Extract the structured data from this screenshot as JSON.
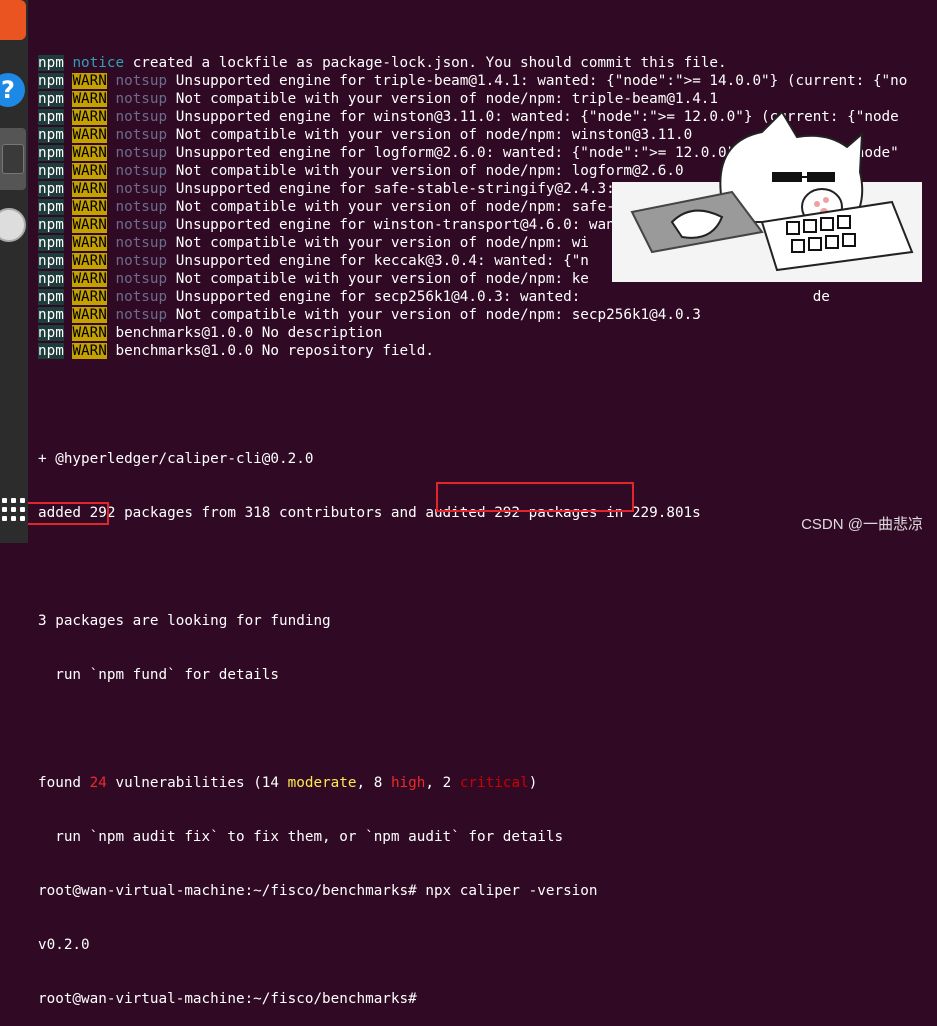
{
  "terminal": {
    "lines": [
      {
        "prefix": "npm",
        "tag": "notice",
        "tag_type": "notice",
        "rest": " created a lockfile as package-lock.json. You should commit this file."
      },
      {
        "prefix": "npm",
        "tag": "WARN",
        "tag_type": "warn",
        "code": "notsup",
        "rest": " Unsupported engine for triple-beam@1.4.1: wanted: {\"node\":\">= 14.0.0\"} (current: {\"no"
      },
      {
        "prefix": "npm",
        "tag": "WARN",
        "tag_type": "warn",
        "code": "notsup",
        "rest": " Not compatible with your version of node/npm: triple-beam@1.4.1"
      },
      {
        "prefix": "npm",
        "tag": "WARN",
        "tag_type": "warn",
        "code": "notsup",
        "rest": " Unsupported engine for winston@3.11.0: wanted: {\"node\":\">= 12.0.0\"} (current: {\"node"
      },
      {
        "prefix": "npm",
        "tag": "WARN",
        "tag_type": "warn",
        "code": "notsup",
        "rest": " Not compatible with your version of node/npm: winston@3.11.0"
      },
      {
        "prefix": "npm",
        "tag": "WARN",
        "tag_type": "warn",
        "code": "notsup",
        "rest": " Unsupported engine for logform@2.6.0: wanted: {\"node\":\">= 12.0.0\"} (current: {\"node\""
      },
      {
        "prefix": "npm",
        "tag": "WARN",
        "tag_type": "warn",
        "code": "notsup",
        "rest": " Not compatible with your version of node/npm: logform@2.6.0"
      },
      {
        "prefix": "npm",
        "tag": "WARN",
        "tag_type": "warn",
        "code": "notsup",
        "rest": " Unsupported engine for safe-stable-stringify@2.4.3: wanted: {\"node\":\">= 10\"} (current"
      },
      {
        "prefix": "npm",
        "tag": "WARN",
        "tag_type": "warn",
        "code": "notsup",
        "rest": " Not compatible with your version of node/npm: safe-stable"
      },
      {
        "prefix": "npm",
        "tag": "WARN",
        "tag_type": "warn",
        "code": "notsup",
        "rest": " Unsupported engine for winston-transport@4.6.0: wanted:                 } (curren"
      },
      {
        "prefix": "npm",
        "tag": "WARN",
        "tag_type": "warn",
        "code": "notsup",
        "rest": " Not compatible with your version of node/npm: wi"
      },
      {
        "prefix": "npm",
        "tag": "WARN",
        "tag_type": "warn",
        "code": "notsup",
        "rest": " Unsupported engine for keccak@3.0.4: wanted: {\"n                         \"node\":\""
      },
      {
        "prefix": "npm",
        "tag": "WARN",
        "tag_type": "warn",
        "code": "notsup",
        "rest": " Not compatible with your version of node/npm: ke"
      },
      {
        "prefix": "npm",
        "tag": "WARN",
        "tag_type": "warn",
        "code": "notsup",
        "rest": " Unsupported engine for secp256k1@4.0.3: wanted:                           de"
      },
      {
        "prefix": "npm",
        "tag": "WARN",
        "tag_type": "warn",
        "code": "notsup",
        "rest": " Not compatible with your version of node/npm: secp256k1@4.0.3"
      },
      {
        "prefix": "npm",
        "tag": "WARN",
        "tag_type": "warn",
        "rest": " benchmarks@1.0.0 No description"
      },
      {
        "prefix": "npm",
        "tag": "WARN",
        "tag_type": "warn",
        "rest": " benchmarks@1.0.0 No repository field."
      }
    ],
    "blank1": "",
    "installed": "+ @hyperledger/caliper-cli@0.2.0",
    "added": "added 292 packages from 318 contributors and audited 292 packages in 229.801s",
    "blank2": "",
    "funding1": "3 packages are looking for funding",
    "funding2": "  run `npm fund` for details",
    "blank3": "",
    "vuln_pre": "found ",
    "vuln_count": "24",
    "vuln_mid1": " vulnerabilities (14 ",
    "vuln_moderate": "moderate",
    "vuln_mid2": ", 8 ",
    "vuln_high": "high",
    "vuln_mid3": ", 2 ",
    "vuln_critical": "critical",
    "vuln_end": ")",
    "audit_fix": "  run `npm audit fix` to fix them, or `npm audit` for details",
    "prompt1": "root@wan-virtual-machine:~/fisco/benchmarks# ",
    "command": "npx caliper -version",
    "version": "v0.2.0",
    "prompt2": "root@wan-virtual-machine:~/fisco/benchmarks# "
  },
  "watermark": "CSDN @一曲悲凉",
  "colors": {
    "bg": "#300a24",
    "warn": "#c4a000",
    "highlight_box": "#e0262a"
  }
}
